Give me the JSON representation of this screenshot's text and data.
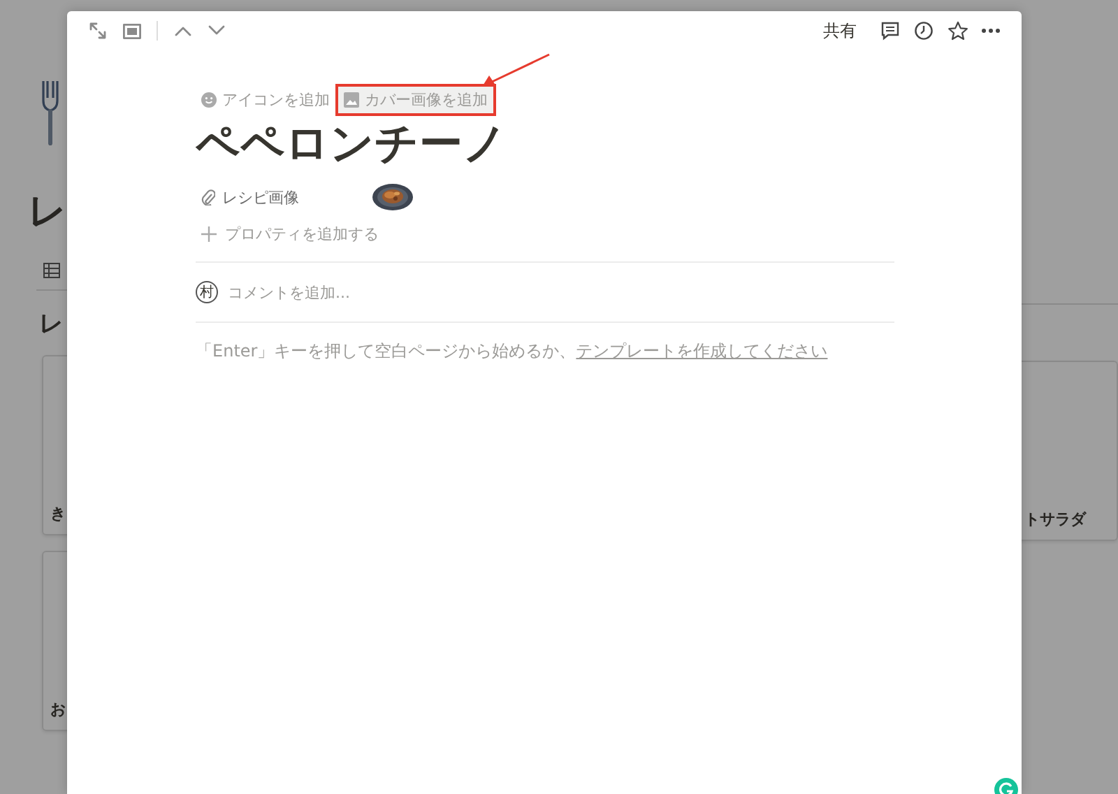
{
  "background_page": {
    "heading": "レ",
    "section_heading": "レ",
    "left_cards": [
      {
        "title": "き"
      },
      {
        "title": "お"
      }
    ],
    "right_cards": [
      {
        "title": "トサラダ"
      }
    ]
  },
  "modal": {
    "toolbar": {
      "share": "共有"
    },
    "page_actions": [
      {
        "label": "アイコンを追加",
        "kind": "icon",
        "highlighted": false
      },
      {
        "label": "カバー画像を追加",
        "kind": "cover",
        "highlighted": true
      }
    ],
    "title": "ペペロンチーノ",
    "properties": [
      {
        "name": "レシピ画像",
        "kind": "files"
      }
    ],
    "add_property": "プロパティを追加する",
    "comment": {
      "avatar": "村",
      "placeholder": "コメントを追加..."
    },
    "empty_hint": {
      "text": "「Enter」キーを押して空白ページから始めるか、",
      "link": "テンプレートを作成してください"
    }
  }
}
